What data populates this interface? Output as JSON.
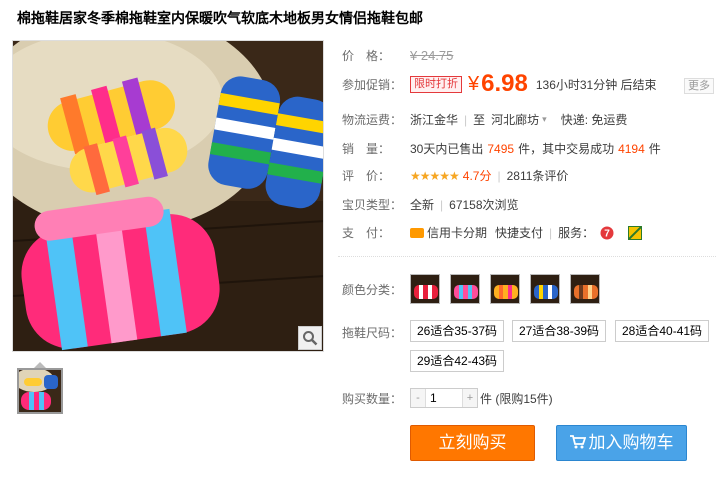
{
  "title": "棉拖鞋居家冬季棉拖鞋室内保暖吹气软底木地板男女情侣拖鞋包邮",
  "price": {
    "label": "价　格：",
    "original": "¥ 24.75"
  },
  "promo": {
    "label": "参加促销：",
    "tag": "限时打折",
    "yen": "¥",
    "price": "6.98",
    "countdown": "136小时31分钟 后结束",
    "more": "更多"
  },
  "shipping": {
    "label": "物流运费：",
    "from": "浙江金华",
    "to_prefix": "至",
    "to": "河北廊坊",
    "express": "快递: 免运费"
  },
  "sales": {
    "label": "销　量：",
    "prefix": "30天内已售出",
    "sold": "7495",
    "middle": "件，其中交易成功",
    "success": "4194",
    "suffix": "件"
  },
  "rating": {
    "label": "评　价：",
    "stars": "★★★★★",
    "score": "4.7分",
    "reviews": "2811条评价"
  },
  "item_type": {
    "label": "宝贝类型：",
    "value": "全新",
    "views": "67158次浏览"
  },
  "payment": {
    "label": "支　付：",
    "credit": "信用卡分期",
    "quick": "快捷支付",
    "service_label": "服务："
  },
  "colors": {
    "label": "颜色分类：",
    "swatches": [
      "red",
      "pink",
      "orange",
      "blue",
      "brown"
    ]
  },
  "sizes": {
    "label": "拖鞋尺码：",
    "options": [
      "26适合35-37码",
      "27适合38-39码",
      "28适合40-41码",
      "29适合42-43码"
    ]
  },
  "quantity": {
    "label": "购买数量：",
    "value": "1",
    "minus": "-",
    "plus": "+",
    "unit": "件 (限购15件)"
  },
  "actions": {
    "buy_now": "立刻购买",
    "add_cart": "加入购物车"
  }
}
